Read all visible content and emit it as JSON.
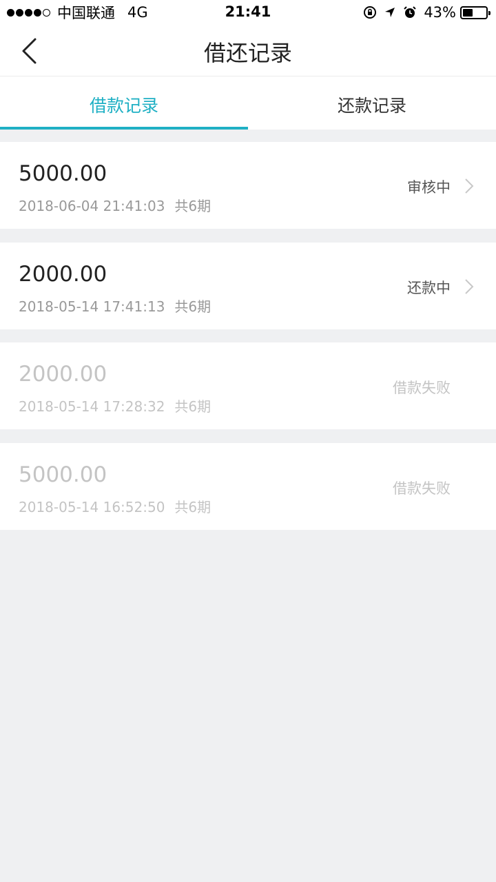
{
  "status_bar": {
    "carrier": "中国联通",
    "network": "4G",
    "time": "21:41",
    "battery": "43%",
    "battery_level": 0.43,
    "icons": [
      "orientation-lock-icon",
      "location-arrow-icon",
      "alarm-icon"
    ]
  },
  "nav": {
    "title": "借还记录",
    "back_icon": "chevron-left-icon"
  },
  "tabs": [
    {
      "label": "借款记录",
      "active": true
    },
    {
      "label": "还款记录",
      "active": false
    }
  ],
  "records": [
    {
      "amount": "5000.00",
      "datetime": "2018-06-04 21:41:03",
      "periods": "共6期",
      "status": "审核中",
      "has_chevron": true,
      "failed": false
    },
    {
      "amount": "2000.00",
      "datetime": "2018-05-14 17:41:13",
      "periods": "共6期",
      "status": "还款中",
      "has_chevron": true,
      "failed": false
    },
    {
      "amount": "2000.00",
      "datetime": "2018-05-14 17:28:32",
      "periods": "共6期",
      "status": "借款失败",
      "has_chevron": false,
      "failed": true
    },
    {
      "amount": "5000.00",
      "datetime": "2018-05-14 16:52:50",
      "periods": "共6期",
      "status": "借款失败",
      "has_chevron": false,
      "failed": true
    }
  ],
  "colors": {
    "accent": "#1fb0c4",
    "background": "#eff0f2",
    "failed_text": "#c4c4c4"
  }
}
